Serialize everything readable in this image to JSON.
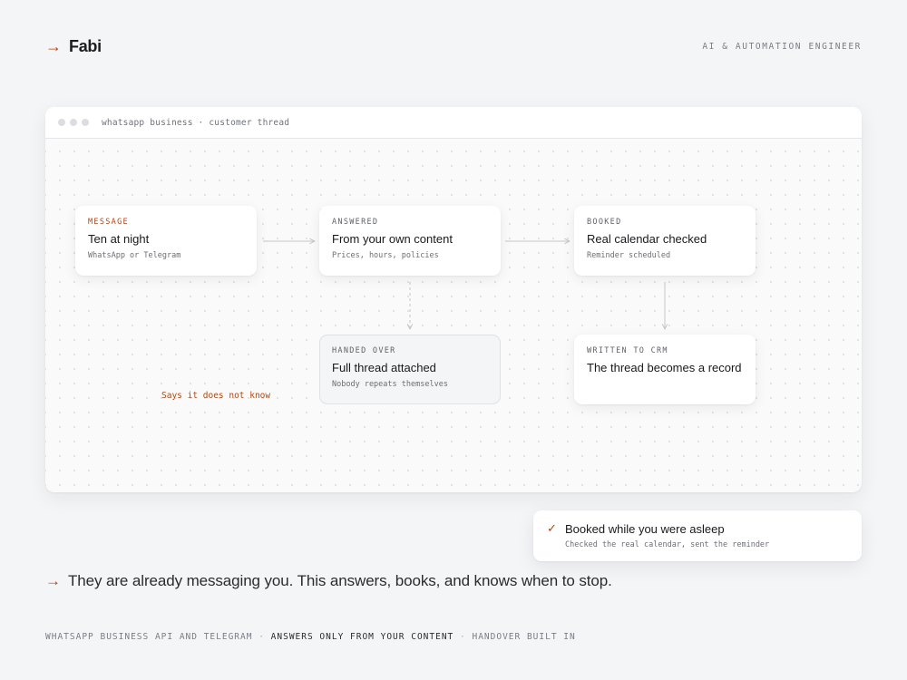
{
  "header": {
    "arrow": "→",
    "brand": "Fabi",
    "role": "AI & AUTOMATION ENGINEER"
  },
  "window": {
    "title": "whatsapp business · customer thread"
  },
  "nodes": {
    "message": {
      "tag": "MESSAGE",
      "title": "Ten at night",
      "sub": "WhatsApp or Telegram"
    },
    "answered": {
      "tag": "ANSWERED",
      "title": "From your own content",
      "sub": "Prices, hours, policies"
    },
    "booked": {
      "tag": "BOOKED",
      "title": "Real calendar checked",
      "sub": "Reminder scheduled"
    },
    "handed_over": {
      "tag": "HANDED OVER",
      "title": "Full thread attached",
      "sub": "Nobody repeats themselves"
    },
    "crm": {
      "tag": "WRITTEN TO CRM",
      "title": "The thread becomes a record"
    }
  },
  "edge_label": "Says it does not know",
  "toast": {
    "check": "✓",
    "title": "Booked while you were asleep",
    "sub": "Checked the real calendar, sent the reminder"
  },
  "tagline": {
    "arrow": "→",
    "text": "They are already messaging you. This answers, books, and knows when to stop."
  },
  "footer": {
    "part1": "WHATSAPP BUSINESS API AND TELEGRAM",
    "sep1": "·",
    "part2": "ANSWERS ONLY FROM YOUR CONTENT",
    "sep2": "·",
    "part3": "HANDOVER BUILT IN"
  },
  "colors": {
    "accent": "#c2410c",
    "background": "#f4f5f7"
  }
}
